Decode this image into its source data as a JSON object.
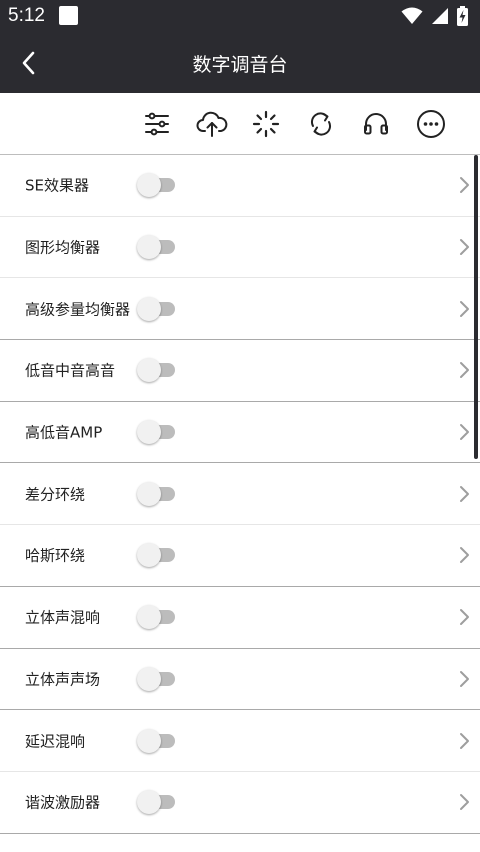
{
  "status_bar": {
    "time": "5:12",
    "icons": [
      "notification-square-icon",
      "wifi-icon",
      "signal-icon",
      "battery-charging-icon"
    ]
  },
  "app_bar": {
    "title": "数字调音台",
    "back_icon": "chevron-left-icon"
  },
  "toolbar": {
    "icons": [
      "equalizer-settings-icon",
      "cloud-upload-icon",
      "loading-spinner-icon",
      "refresh-icon",
      "headphones-icon",
      "more-options-icon"
    ]
  },
  "effects": [
    {
      "label": "SE效果器",
      "enabled": false
    },
    {
      "label": "图形均衡器",
      "enabled": false
    },
    {
      "label": "高级参量均衡器",
      "enabled": false
    },
    {
      "label": "低音中音高音",
      "enabled": false
    },
    {
      "label": "高低音AMP",
      "enabled": false
    },
    {
      "label": "差分环绕",
      "enabled": false
    },
    {
      "label": "哈斯环绕",
      "enabled": false
    },
    {
      "label": "立体声混响",
      "enabled": false
    },
    {
      "label": "立体声声场",
      "enabled": false
    },
    {
      "label": "延迟混响",
      "enabled": false
    },
    {
      "label": "谐波激励器",
      "enabled": false
    }
  ],
  "colors": {
    "bar_bg": "#2b2b30",
    "toggle_track": "#bcbcbc",
    "toggle_thumb": "#f1f1f1"
  }
}
